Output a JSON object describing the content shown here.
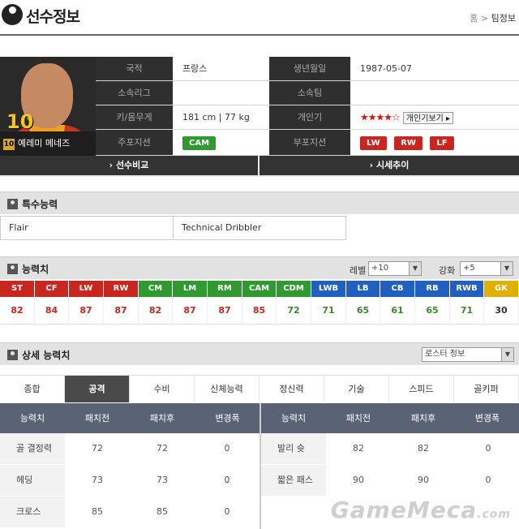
{
  "header": {
    "title": "선수정보",
    "breadcrumb_home": "홈",
    "breadcrumb_sep": ">",
    "breadcrumb_current": "팀정보"
  },
  "player": {
    "back_number": "10",
    "badge": "10",
    "name": "예레미 메네즈",
    "info": {
      "nationality_label": "국적",
      "nationality": "프랑스",
      "birth_label": "생년월일",
      "birth": "1987-05-07",
      "league_label": "소속리그",
      "league": "",
      "team_label": "소속팀",
      "team": "",
      "body_label": "키/몸무게",
      "body": "181 cm  |  77 kg",
      "popularity_label": "개인기",
      "stars": "★★★★☆",
      "skill_button": "개인기보기 ▸",
      "main_pos_label": "주포지션",
      "main_pos": "CAM",
      "sub_pos_label": "부포지션",
      "sub_positions": [
        "LW",
        "RW",
        "LF"
      ]
    },
    "compare_button": "› 선수비교",
    "price_button": "› 시세추이"
  },
  "traits": {
    "title": "특수능력",
    "items": [
      "Flair",
      "Technical Dribbler"
    ]
  },
  "ability": {
    "title": "능력치",
    "level_label": "레벨",
    "level_value": "+10",
    "enhance_label": "강화",
    "enhance_value": "+5",
    "positions": [
      "ST",
      "CF",
      "LW",
      "RW",
      "CM",
      "LM",
      "RM",
      "CAM",
      "CDM",
      "LWB",
      "LB",
      "CB",
      "RB",
      "RWB",
      "GK"
    ],
    "values": [
      "82",
      "84",
      "87",
      "87",
      "82",
      "87",
      "87",
      "85",
      "72",
      "71",
      "65",
      "61",
      "65",
      "71",
      "30"
    ],
    "colors": {
      "attack": "#c8261e",
      "mid": "#2f9a2f",
      "def": "#2060c0",
      "gk": "#e0b000"
    }
  },
  "detail": {
    "title": "상세 능력치",
    "roster_select": "로스터 정보",
    "tabs": [
      "종합",
      "공격",
      "수비",
      "신체능력",
      "정신력",
      "기술",
      "스피드",
      "골키퍼"
    ],
    "active_tab": "공격",
    "headers": [
      "능력치",
      "패치전",
      "패치후",
      "변경폭"
    ],
    "left_rows": [
      {
        "name": "골 결정력",
        "before": "72",
        "after": "72",
        "diff": "0"
      },
      {
        "name": "헤딩",
        "before": "73",
        "after": "73",
        "diff": "0"
      },
      {
        "name": "크로스",
        "before": "85",
        "after": "85",
        "diff": "0"
      }
    ],
    "right_rows": [
      {
        "name": "발리 슛",
        "before": "82",
        "after": "82",
        "diff": "0"
      },
      {
        "name": "짧은 패스",
        "before": "90",
        "after": "90",
        "diff": "0"
      }
    ]
  },
  "watermark": "GameMeca",
  "watermark_suffix": ".com"
}
